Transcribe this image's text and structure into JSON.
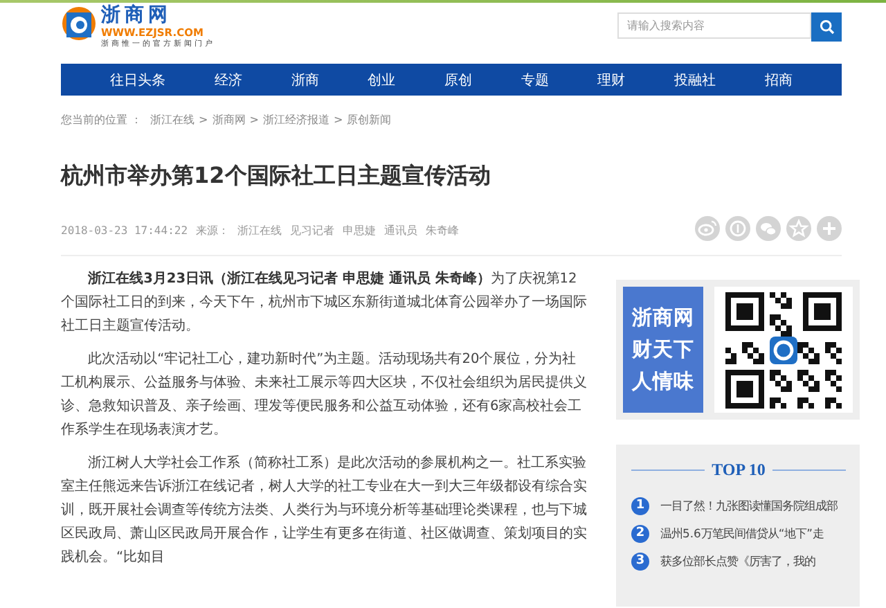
{
  "logo": {
    "name": "浙商网",
    "url": "WWW.EZJSR.COM",
    "tagline": "浙商惟一的官方新闻门户"
  },
  "search": {
    "placeholder": "请输入搜索内容"
  },
  "nav": [
    {
      "label": "往日头条"
    },
    {
      "label": "经济"
    },
    {
      "label": "浙商"
    },
    {
      "label": "创业"
    },
    {
      "label": "原创"
    },
    {
      "label": "专题"
    },
    {
      "label": "理财"
    },
    {
      "label": "投融社"
    },
    {
      "label": "招商"
    }
  ],
  "breadcrumb": {
    "label": "您当前的位置 ：",
    "items": [
      "浙江在线",
      "浙商网",
      "浙江经济报道",
      "原创新闻"
    ],
    "separator": ">"
  },
  "article": {
    "title": "杭州市举办第12个国际社工日主题宣传活动",
    "date": "2018-03-23 17:44:22",
    "source_label": "来源：",
    "source": "浙江在线",
    "byline": [
      "见习记者",
      "申思婕",
      "通讯员",
      "朱奇峰"
    ],
    "share_icons": [
      {
        "kind": "swirl"
      },
      {
        "kind": "coin"
      },
      {
        "kind": "chat"
      },
      {
        "kind": "star"
      },
      {
        "kind": "plus"
      }
    ],
    "paragraphs": [
      "**浙江在线3月23日讯（浙江在线见习记者 申思婕 通讯员 朱奇峰）**为了庆祝第12个国际社工日的到来，今天下午，杭州市下城区东新街道城北体育公园举办了一场国际社工日主题宣传活动。",
      "此次活动以“牢记社工心，建功新时代”为主题。活动现场共有20个展位，分为社工机构展示、公益服务与体验、未来社工展示等四大区块，不仅社会组织为居民提供义诊、急救知识普及、亲子绘画、理发等便民服务和公益互动体验，还有6家高校社会工作系学生在现场表演才艺。",
      "浙江树人大学社会工作系（简称社工系）是此次活动的参展机构之一。社工系实验室主任熊远来告诉浙江在线记者，树人大学的社工专业在大一到大三年级都设有综合实训，既开展社会调查等传统方法类、人类行为与环境分析等基础理论类课程，也与下城区民政局、萧山区民政局开展合作，让学生有更多在街道、社区做调查、策划项目的实践机会。“比如目"
    ]
  },
  "promo": {
    "lines": [
      "浙商网",
      "财天下",
      "人情味"
    ]
  },
  "top10": {
    "title": "TOP 10",
    "items": [
      {
        "rank": "1",
        "text": "一目了然！九张图读懂国务院组成部"
      },
      {
        "rank": "2",
        "text": "温州5.6万笔民间借贷从“地下”走"
      },
      {
        "rank": "3",
        "text": "获多位部长点赞《厉害了，我的"
      }
    ]
  }
}
